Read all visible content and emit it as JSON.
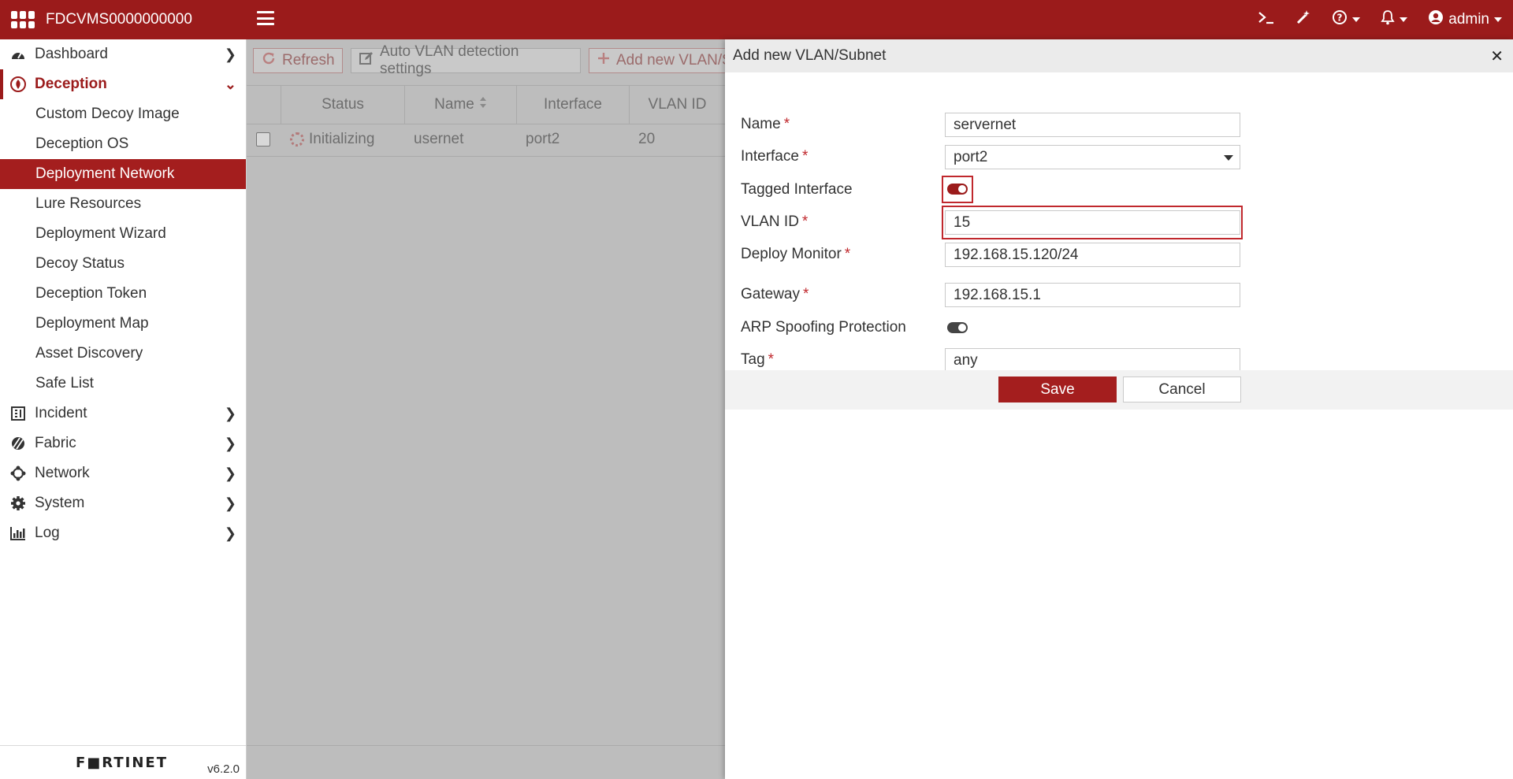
{
  "topbar": {
    "hostname": "FDCVMS0000000000",
    "user": "admin",
    "icons": [
      "terminal-icon",
      "magic-wand-icon",
      "help-icon",
      "bell-icon",
      "user-icon"
    ]
  },
  "sidebar": {
    "items": [
      {
        "label": "Dashboard",
        "icon": "dashboard-icon"
      },
      {
        "label": "Deception",
        "icon": "deception-icon"
      },
      {
        "label": "Incident",
        "icon": "incident-icon"
      },
      {
        "label": "Fabric",
        "icon": "fabric-icon"
      },
      {
        "label": "Network",
        "icon": "network-icon"
      },
      {
        "label": "System",
        "icon": "gear-icon"
      },
      {
        "label": "Log",
        "icon": "chart-icon"
      }
    ],
    "deception_sub": [
      "Custom Decoy Image",
      "Deception OS",
      "Deployment Network",
      "Lure Resources",
      "Deployment Wizard",
      "Decoy Status",
      "Deception Token",
      "Deployment Map",
      "Asset Discovery",
      "Safe List"
    ],
    "active_sub": "Deployment Network",
    "brand": "F■RTINET",
    "version": "v6.2.0"
  },
  "main": {
    "toolbar": {
      "refresh": "Refresh",
      "auto_vlan": "Auto VLAN detection settings",
      "add_new": "Add new VLAN/S"
    },
    "columns": [
      "Status",
      "Name",
      "Interface",
      "VLAN ID"
    ],
    "rows": [
      {
        "status": "Initializing",
        "name": "usernet",
        "interface": "port2",
        "vlan_id": "20"
      }
    ]
  },
  "dialog": {
    "title": "Add new VLAN/Subnet",
    "fields": {
      "name_label": "Name",
      "name_value": "servernet",
      "interface_label": "Interface",
      "interface_value": "port2",
      "tagged_label": "Tagged Interface",
      "tagged_on": true,
      "vlan_label": "VLAN ID",
      "vlan_value": "15",
      "monitor_label": "Deploy Monitor",
      "monitor_value": "192.168.15.120/24",
      "gateway_label": "Gateway",
      "gateway_value": "192.168.15.1",
      "arp_label": "ARP Spoofing Protection",
      "arp_on": false,
      "tag_label": "Tag",
      "tag_value": "any",
      "required_mark": "*"
    },
    "save": "Save",
    "cancel": "Cancel"
  },
  "colors": {
    "brand": "#9b1b1b",
    "active": "#a41e1e",
    "highlight": "#c0282d"
  }
}
